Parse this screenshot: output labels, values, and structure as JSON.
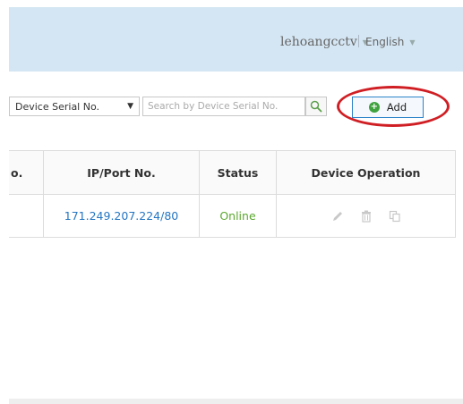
{
  "header": {
    "username": "lehoangcctv",
    "language": "English"
  },
  "toolbar": {
    "filter_select_value": "Device Serial No.",
    "search_placeholder": "Search by Device Serial No.",
    "add_label": "Add"
  },
  "table": {
    "columns": [
      "o.",
      "IP/Port No.",
      "Status",
      "Device Operation"
    ],
    "rows": [
      {
        "no": "",
        "ip_port": "171.249.207.224/80",
        "status": "Online",
        "operations": [
          "edit-icon",
          "delete-icon",
          "copy-icon"
        ]
      }
    ]
  },
  "colors": {
    "header_bg": "#d4e6f3",
    "link_blue": "#2476c2",
    "online_green": "#5ba82f",
    "highlight_red": "#d01f24",
    "add_border": "#2a82c9"
  }
}
